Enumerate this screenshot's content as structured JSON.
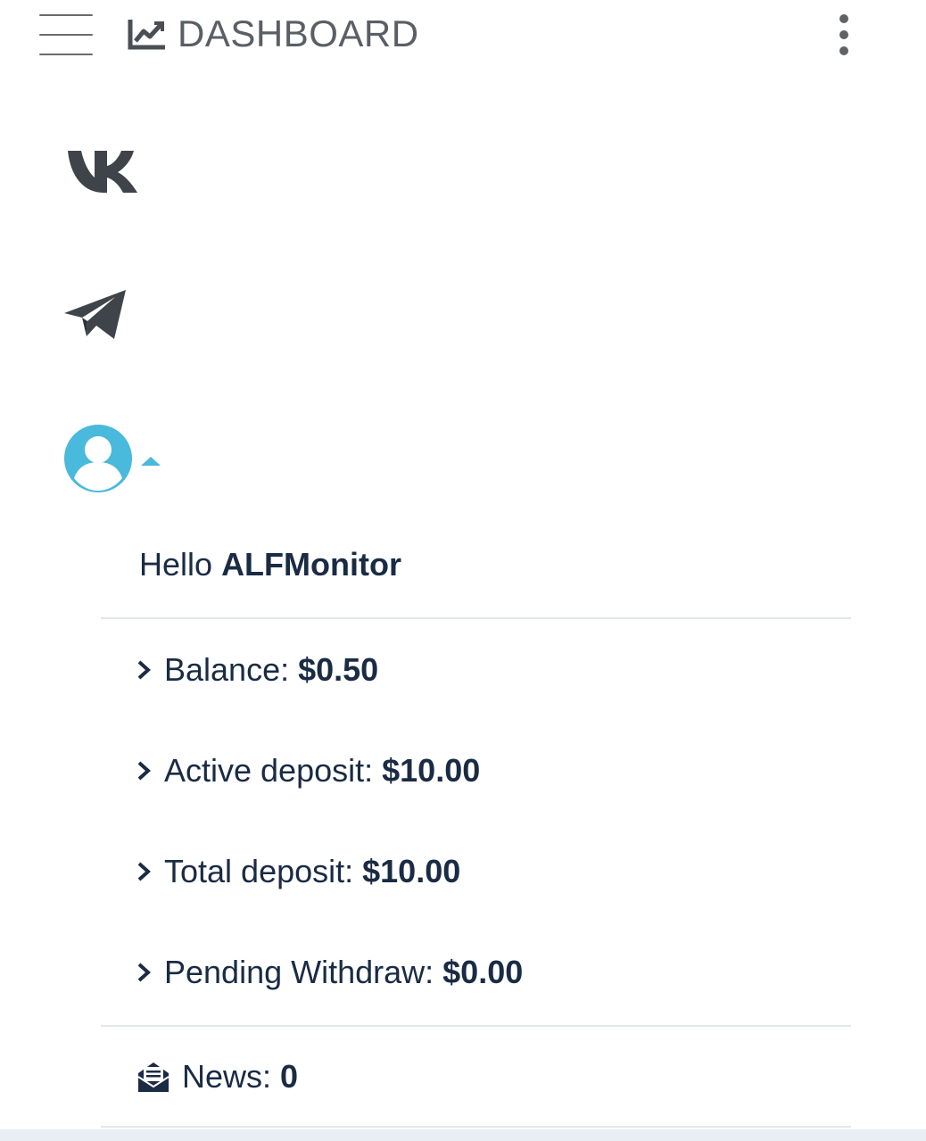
{
  "header": {
    "title": "DASHBOARD",
    "menu_icon": "hamburger-icon",
    "title_icon": "line-chart-icon",
    "overflow_icon": "kebab-menu-icon"
  },
  "social": {
    "vk_icon": "vk-icon",
    "telegram_icon": "telegram-icon"
  },
  "user": {
    "avatar_icon": "user-circle-icon",
    "caret_icon": "caret-up-icon",
    "greeting_prefix": "Hello",
    "username": "ALFMonitor"
  },
  "stats": [
    {
      "label": "Balance:",
      "value": "$0.50"
    },
    {
      "label": "Active deposit:",
      "value": "$10.00"
    },
    {
      "label": "Total deposit:",
      "value": "$10.00"
    },
    {
      "label": "Pending Withdraw:",
      "value": "$0.00"
    }
  ],
  "news": {
    "icon": "envelope-open-icon",
    "label": "News:",
    "value": "0"
  },
  "colors": {
    "text": "#1a2b44",
    "icon_gray": "#4a4f55",
    "accent": "#49b9dc",
    "divider": "#e4e7ea"
  }
}
